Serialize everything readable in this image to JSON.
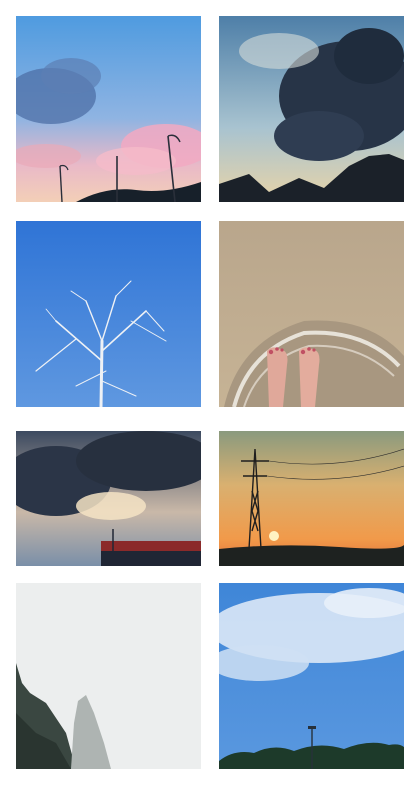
{
  "gallery": {
    "photos": [
      {
        "subject": "pastel-sky-streetlights",
        "sky": "#6fa6df"
      },
      {
        "subject": "dramatic-clouds-mountains",
        "sky": "#8fb1c4"
      },
      {
        "subject": "bare-tree-blue-sky",
        "sky": "#3b7fd8"
      },
      {
        "subject": "feet-on-beach",
        "sky": "#c6ae8e"
      },
      {
        "subject": "storm-clouds-sunset-building",
        "sky": "#46586e"
      },
      {
        "subject": "pylon-sunset",
        "sky": "#e59a4d"
      },
      {
        "subject": "misty-karst-peaks",
        "sky": "#e9ecec"
      },
      {
        "subject": "cloudy-blue-sky-treeline",
        "sky": "#4f90da"
      }
    ]
  }
}
